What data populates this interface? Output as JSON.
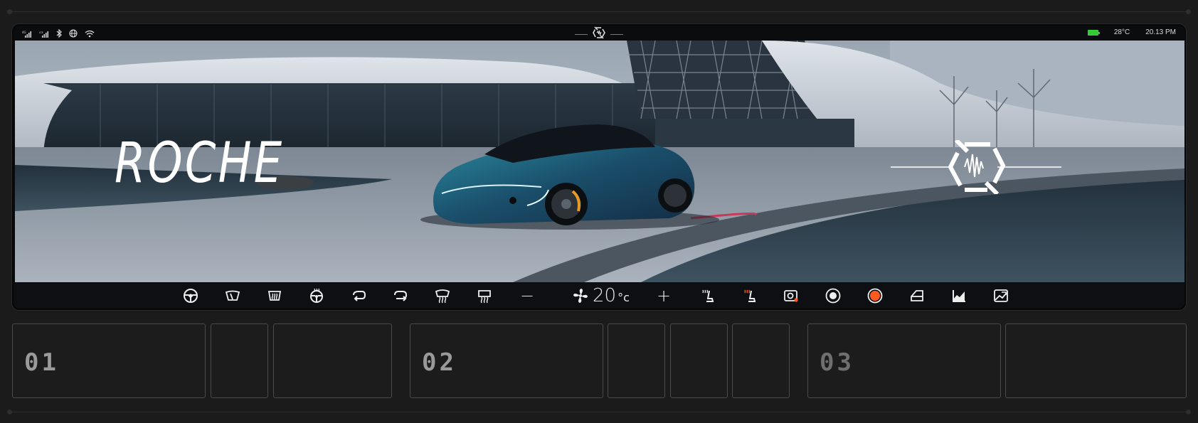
{
  "status_bar": {
    "signal_1": "4G",
    "signal_2": "LTE",
    "temperature": "28°C",
    "time": "20.13 PM",
    "battery_color": "#35c935",
    "icons": [
      "signal-icon",
      "signal-lte-icon",
      "bluetooth-icon",
      "globe-icon",
      "wifi-icon",
      "brand-logo-icon",
      "battery-icon"
    ]
  },
  "hero": {
    "brand": "ROCHE",
    "emblem_icon": "brand-emblem-icon"
  },
  "controls": {
    "items": [
      {
        "name": "steering-wheel-icon"
      },
      {
        "name": "windshield-wiper-icon"
      },
      {
        "name": "rear-defrost-icon"
      },
      {
        "name": "heated-steering-icon"
      },
      {
        "name": "recirculation-icon"
      },
      {
        "name": "fresh-air-icon"
      },
      {
        "name": "front-defrost-icon"
      },
      {
        "name": "rear-window-defrost-icon"
      },
      {
        "name": "minus-icon"
      },
      {
        "name": "fan-icon"
      },
      {
        "name": "plus-icon"
      },
      {
        "name": "seat-heat-icon"
      },
      {
        "name": "seat-heat-active-icon"
      },
      {
        "name": "camera-icon"
      },
      {
        "name": "target-icon"
      },
      {
        "name": "record-icon"
      },
      {
        "name": "door-icon"
      },
      {
        "name": "chart-icon"
      },
      {
        "name": "image-icon"
      }
    ],
    "temperature_value": "20",
    "temperature_unit": "°c",
    "minus_label": "−",
    "plus_label": "+",
    "accent_color": "#ff5a1f"
  },
  "panels": [
    {
      "label": "01"
    },
    {
      "label": "02"
    },
    {
      "label": "03"
    }
  ]
}
